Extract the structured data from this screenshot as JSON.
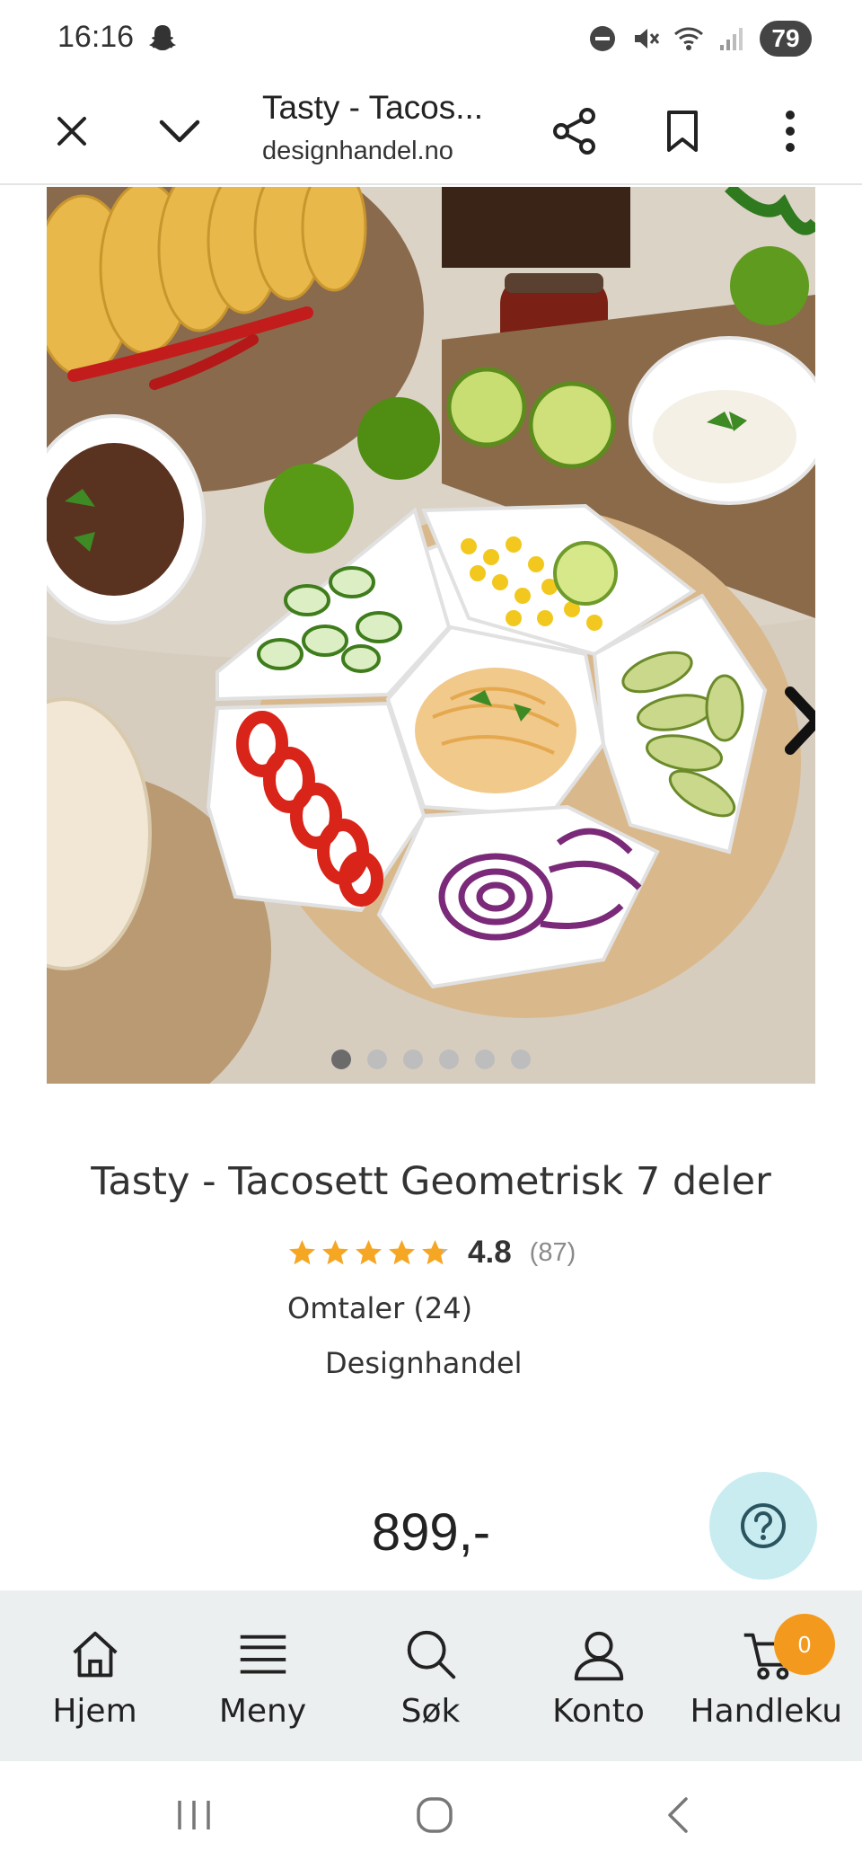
{
  "status_bar": {
    "time": "16:16",
    "battery": "79",
    "icons": [
      "snapchat-ghost-icon",
      "do-not-disturb-icon",
      "mute-icon",
      "wifi-icon",
      "signal-icon"
    ]
  },
  "browser": {
    "title": "Tasty - Tacos...",
    "url": "designhandel.no",
    "icons": [
      "close-icon",
      "chevron-down-icon",
      "share-icon",
      "bookmark-icon",
      "more-vert-icon"
    ]
  },
  "carousel": {
    "dots": 6,
    "active_index": 0,
    "next_icon": "chevron-right-icon"
  },
  "product": {
    "title": "Tasty - Tacosett Geometrisk 7 deler",
    "rating_value": "4.8",
    "rating_stars": 4.8,
    "rating_count": "(87)",
    "reviews_link": "Omtaler (24)",
    "brand": "Designhandel",
    "price": "899,-"
  },
  "colors": {
    "star": "#f5a623",
    "star_empty": "#b8b8b8",
    "help_fab": "#c9ecf1",
    "cart_badge": "#f39a1e",
    "nav_bg": "#eceff0"
  },
  "help_button": {
    "icon": "help-circle-icon"
  },
  "bottom_nav": {
    "items": [
      {
        "label": "Hjem",
        "icon": "home-icon"
      },
      {
        "label": "Meny",
        "icon": "menu-icon"
      },
      {
        "label": "Søk",
        "icon": "search-icon"
      },
      {
        "label": "Konto",
        "icon": "account-icon"
      },
      {
        "label": "Handlekurv",
        "icon": "cart-icon",
        "badge": "0"
      }
    ]
  },
  "system_nav": {
    "icons": [
      "recent-apps-icon",
      "home-circle-icon",
      "back-icon"
    ]
  }
}
